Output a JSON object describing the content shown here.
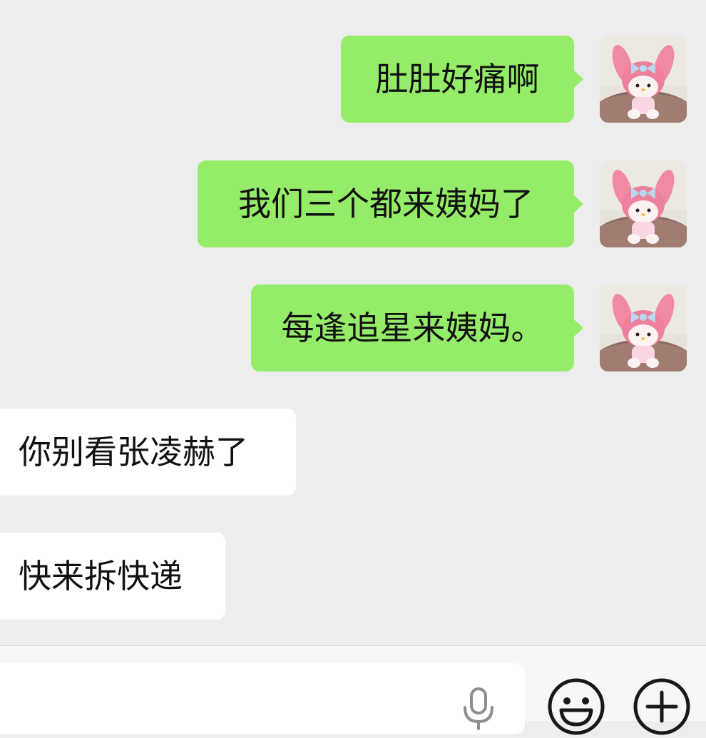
{
  "messages": [
    {
      "side": "sent",
      "text": "肚肚好痛啊"
    },
    {
      "side": "sent",
      "text": "我们三个都来姨妈了"
    },
    {
      "side": "sent",
      "text": "每逢追星来姨妈。"
    },
    {
      "side": "received",
      "text": "你别看张凌赫了"
    },
    {
      "side": "received",
      "text": "快来拆快递"
    }
  ],
  "input": {
    "value": "",
    "placeholder": ""
  },
  "icons": {
    "voice": "microphone-icon",
    "emoji": "smiley-face-icon",
    "more": "plus-circle-icon",
    "avatar": "pink-plush-doll-avatar"
  },
  "colors": {
    "background": "#ededed",
    "sent_bubble": "#95ec69",
    "received_bubble": "#ffffff",
    "input_bar": "#f7f7f7",
    "icon_stroke": "#181818"
  }
}
